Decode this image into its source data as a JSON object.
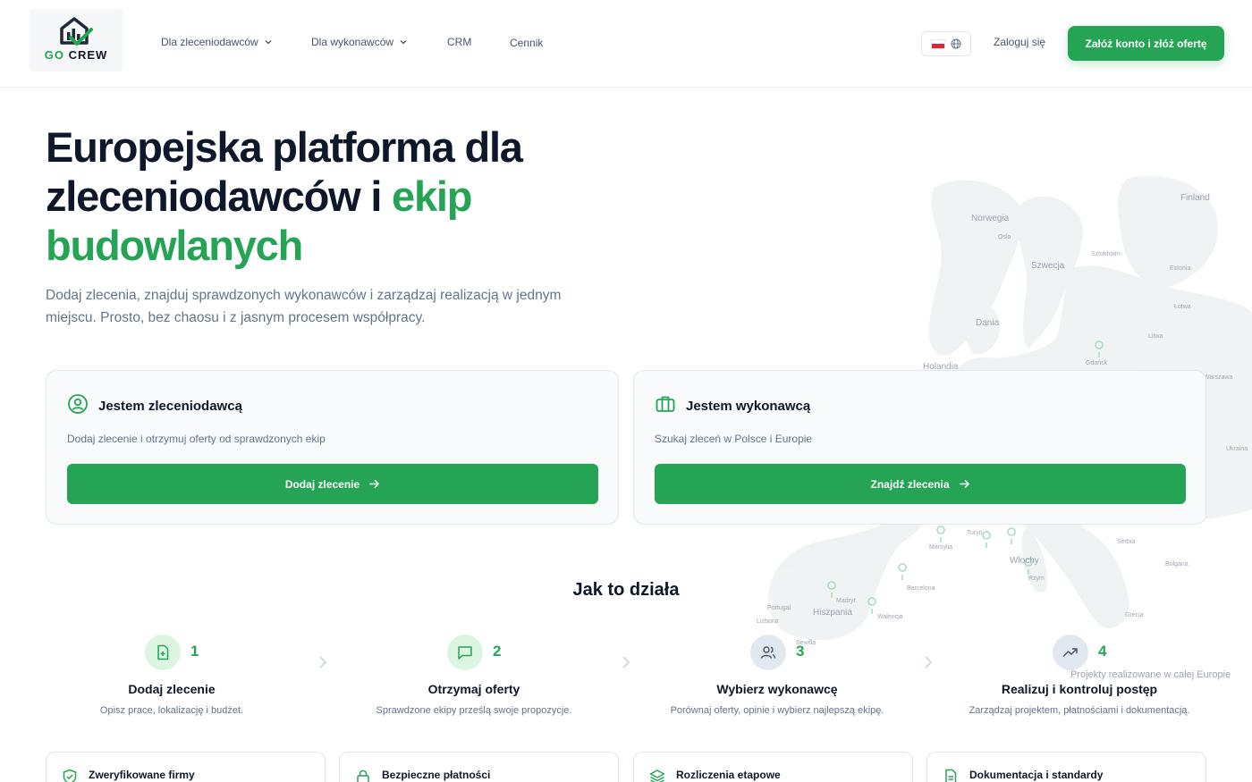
{
  "brand": {
    "logo_go": "GO",
    "logo_crew": "CREW",
    "accent": "#26a455"
  },
  "nav": {
    "items": [
      {
        "label": "Dla zleceniodawców",
        "dropdown": true
      },
      {
        "label": "Dla wykonawców",
        "dropdown": true
      },
      {
        "label": "CRM",
        "dropdown": false
      },
      {
        "label": "Cennik",
        "dropdown": false
      }
    ],
    "language_icon": "globe-icon",
    "login_label": "Zaloguj się",
    "cta_label": "Załóż konto i złóż ofertę"
  },
  "hero": {
    "title_part1": "Europejska platforma dla zleceniodawców i",
    "title_highlight": "ekip budowlanych",
    "subtitle": "Dodaj zlecenia, znajduj sprawdzonych wykonawców i zarządzaj realizacją w jednym miejscu. Prosto, bez chaosu i z jasnym procesem współpracy."
  },
  "cards": [
    {
      "icon": "user-circle-icon",
      "title": "Jestem zleceniodawcą",
      "desc": "Dodaj zlecenie i otrzymuj oferty od sprawdzonych ekip",
      "button": "Dodaj zlecenie"
    },
    {
      "icon": "briefcase-icon",
      "title": "Jestem wykonawcą",
      "desc": "Szukaj zleceń w Polsce i Europie",
      "button": "Znajdź zlecenia"
    }
  ],
  "map": {
    "labels": [
      "Finland",
      "Norwegia",
      "Oslo",
      "Szwecja",
      "Sztokholm",
      "Estonia",
      "Łotwa",
      "Dania",
      "Litwa",
      "Holandia",
      "Gdańsk",
      "Warszawa",
      "Ukraina",
      "Turyn",
      "Marsylia",
      "Serbia",
      "Włochy",
      "Bułgaria",
      "Barcelona",
      "Rzym",
      "Portugal",
      "Madryt",
      "Hiszpania",
      "Walencja",
      "Lizbona",
      "Sewilla",
      "Grecja"
    ],
    "caption": "Projekty realizowane w całej Europie"
  },
  "how": {
    "title": "Jak to działa",
    "steps": [
      {
        "num": "1",
        "icon": "file-plus-icon",
        "title": "Dodaj zlecenie",
        "desc": "Opisz prace, lokalizację i budżet."
      },
      {
        "num": "2",
        "icon": "message-square-icon",
        "title": "Otrzymaj oferty",
        "desc": "Sprawdzone ekipy prześlą swoje propozycje."
      },
      {
        "num": "3",
        "icon": "users-icon",
        "title": "Wybierz wykonawcę",
        "desc": "Porównaj oferty, opinie i wybierz najlepszą ekipę."
      },
      {
        "num": "4",
        "icon": "trending-up-icon",
        "title": "Realizuj i kontroluj postęp",
        "desc": "Zarządzaj projektem, płatnościami i dokumentacją."
      }
    ]
  },
  "features": [
    {
      "icon": "shield-check-icon",
      "title": "Zweryfikowane firmy"
    },
    {
      "icon": "lock-icon",
      "title": "Bezpieczne płatności"
    },
    {
      "icon": "layers-icon",
      "title": "Rozliczenia etapowe"
    },
    {
      "icon": "document-icon",
      "title": "Dokumentacja i standardy"
    }
  ]
}
